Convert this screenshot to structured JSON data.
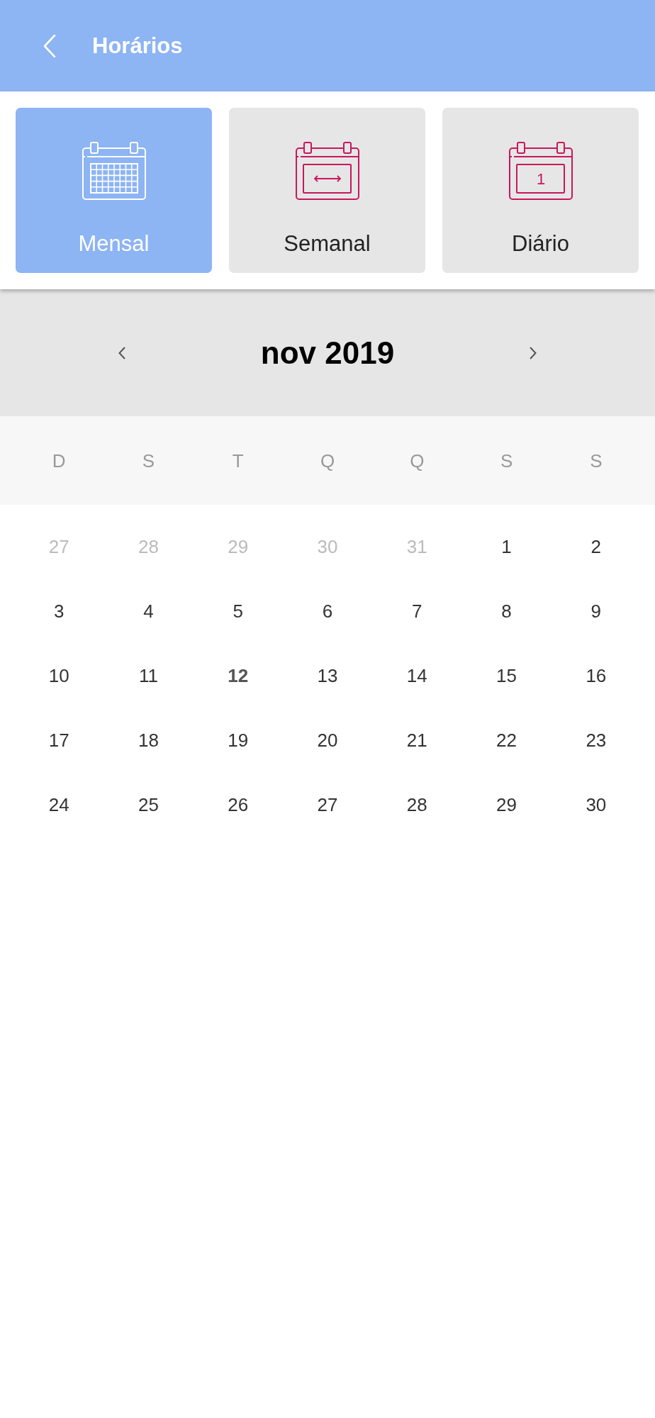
{
  "header": {
    "title": "Horários"
  },
  "view_tabs": [
    {
      "label": "Mensal",
      "kind": "month",
      "selected": true
    },
    {
      "label": "Semanal",
      "kind": "week",
      "selected": false
    },
    {
      "label": "Diário",
      "kind": "day",
      "icon_text": "1",
      "selected": false
    }
  ],
  "calendar": {
    "month_title": "nov 2019",
    "weekdays": [
      "D",
      "S",
      "T",
      "Q",
      "Q",
      "S",
      "S"
    ],
    "weeks": [
      [
        {
          "day": "27",
          "outside_month": true,
          "today": false
        },
        {
          "day": "28",
          "outside_month": true,
          "today": false
        },
        {
          "day": "29",
          "outside_month": true,
          "today": false
        },
        {
          "day": "30",
          "outside_month": true,
          "today": false
        },
        {
          "day": "31",
          "outside_month": true,
          "today": false
        },
        {
          "day": "1",
          "outside_month": false,
          "today": false
        },
        {
          "day": "2",
          "outside_month": false,
          "today": false
        }
      ],
      [
        {
          "day": "3",
          "outside_month": false,
          "today": false
        },
        {
          "day": "4",
          "outside_month": false,
          "today": false
        },
        {
          "day": "5",
          "outside_month": false,
          "today": false
        },
        {
          "day": "6",
          "outside_month": false,
          "today": false
        },
        {
          "day": "7",
          "outside_month": false,
          "today": false
        },
        {
          "day": "8",
          "outside_month": false,
          "today": false
        },
        {
          "day": "9",
          "outside_month": false,
          "today": false
        }
      ],
      [
        {
          "day": "10",
          "outside_month": false,
          "today": false
        },
        {
          "day": "11",
          "outside_month": false,
          "today": false
        },
        {
          "day": "12",
          "outside_month": false,
          "today": true
        },
        {
          "day": "13",
          "outside_month": false,
          "today": false
        },
        {
          "day": "14",
          "outside_month": false,
          "today": false
        },
        {
          "day": "15",
          "outside_month": false,
          "today": false
        },
        {
          "day": "16",
          "outside_month": false,
          "today": false
        }
      ],
      [
        {
          "day": "17",
          "outside_month": false,
          "today": false
        },
        {
          "day": "18",
          "outside_month": false,
          "today": false
        },
        {
          "day": "19",
          "outside_month": false,
          "today": false
        },
        {
          "day": "20",
          "outside_month": false,
          "today": false
        },
        {
          "day": "21",
          "outside_month": false,
          "today": false
        },
        {
          "day": "22",
          "outside_month": false,
          "today": false
        },
        {
          "day": "23",
          "outside_month": false,
          "today": false
        }
      ],
      [
        {
          "day": "24",
          "outside_month": false,
          "today": false
        },
        {
          "day": "25",
          "outside_month": false,
          "today": false
        },
        {
          "day": "26",
          "outside_month": false,
          "today": false
        },
        {
          "day": "27",
          "outside_month": false,
          "today": false
        },
        {
          "day": "28",
          "outside_month": false,
          "today": false
        },
        {
          "day": "29",
          "outside_month": false,
          "today": false
        },
        {
          "day": "30",
          "outside_month": false,
          "today": false
        }
      ]
    ]
  }
}
